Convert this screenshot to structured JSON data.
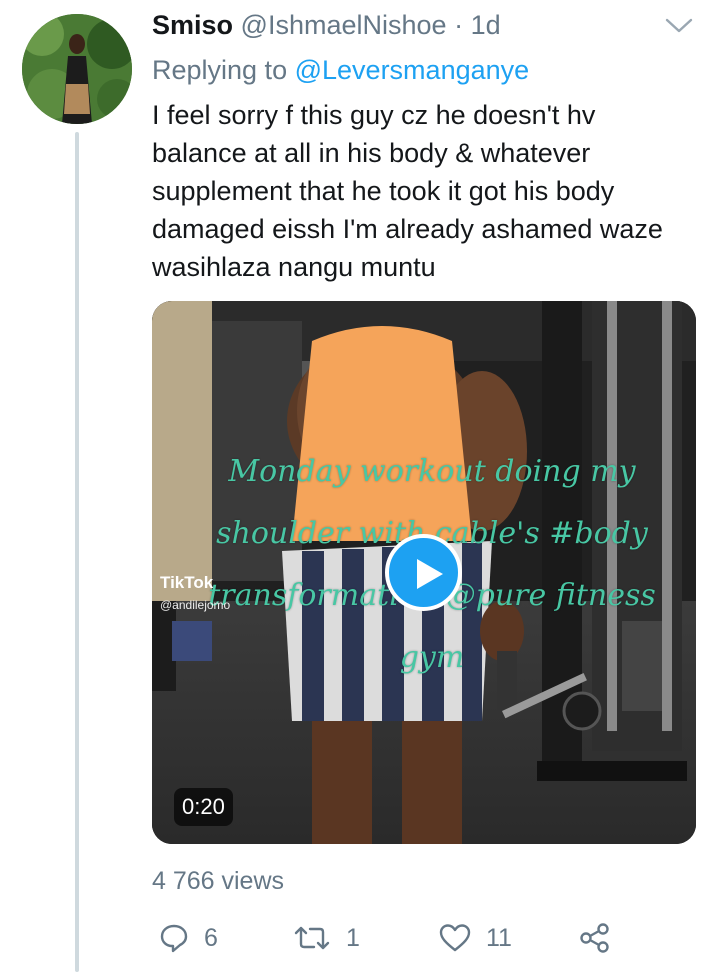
{
  "tweet": {
    "display_name": "Smiso",
    "handle": "@IshmaelNishoe",
    "separator": "·",
    "time": "1d",
    "reply_prefix": "Replying to",
    "reply_mention": "@Leversmanganye",
    "text": "I feel sorry f this guy cz he doesn't hv balance at all in his body & whatever supplement that he took it got his body damaged eissh I'm already ashamed waze wasihlaza nangu muntu"
  },
  "video": {
    "overlay_caption": "Monday workout doing my shoulder with cable's #body transformation @pure fitness gym",
    "watermark_brand": "TikTok",
    "watermark_user": "@andilejomo",
    "duration": "0:20"
  },
  "stats": {
    "views": "4 766 views"
  },
  "actions": {
    "replies": "6",
    "retweets": "1",
    "likes": "11"
  },
  "icons": [
    "chevron-down-icon",
    "reply-icon",
    "retweet-icon",
    "like-icon",
    "share-icon",
    "play-icon"
  ],
  "colors": {
    "link": "#1da1f2",
    "muted": "#657786",
    "text": "#14171a",
    "overlay_text": "#48c7a4"
  }
}
